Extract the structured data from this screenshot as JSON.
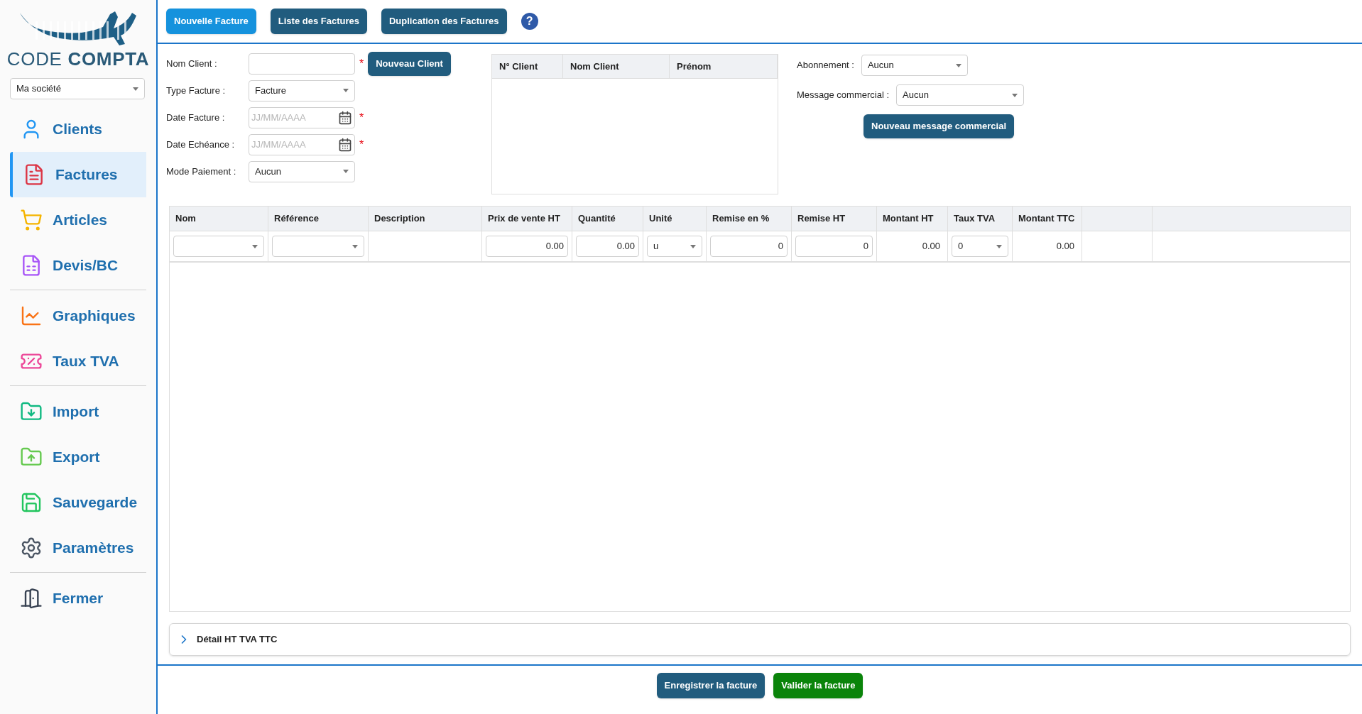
{
  "logo": {
    "word_1": "CODE",
    "word_2": "COMPTA"
  },
  "company_select": {
    "value": "Ma société"
  },
  "nav": [
    {
      "group": [
        {
          "label": "Clients",
          "selected": false
        },
        {
          "label": "Factures",
          "selected": true
        },
        {
          "label": "Articles",
          "selected": false
        },
        {
          "label": "Devis/BC",
          "selected": false
        }
      ]
    },
    {
      "group": [
        {
          "label": "Graphiques",
          "selected": false
        },
        {
          "label": "Taux TVA",
          "selected": false
        }
      ]
    },
    {
      "group": [
        {
          "label": "Import",
          "selected": false
        },
        {
          "label": "Export",
          "selected": false
        },
        {
          "label": "Sauvegarde",
          "selected": false
        },
        {
          "label": "Paramètres",
          "selected": false
        }
      ]
    },
    {
      "group": [
        {
          "label": "Fermer",
          "selected": false
        }
      ]
    }
  ],
  "top_tabs": [
    {
      "label": "Nouvelle Facture",
      "selected": true
    },
    {
      "label": "Liste des Factures",
      "selected": false
    },
    {
      "label": "Duplication des Factures",
      "selected": false
    }
  ],
  "help": {
    "label": "?"
  },
  "form": [
    {
      "label": "Nom Client :",
      "kind": "input",
      "required": true
    },
    {
      "label": "Type Facture :",
      "kind": "select",
      "value": "Facture",
      "required": false
    },
    {
      "label": "Date Facture :",
      "kind": "date",
      "placeholder": "JJ/MM/AAAA",
      "required": true
    },
    {
      "label": "Date Echéance :",
      "kind": "date",
      "placeholder": "JJ/MM/AAAA",
      "required": true
    },
    {
      "label": "Mode Paiement :",
      "kind": "select",
      "value": "Aucun",
      "required": false
    }
  ],
  "required_mark": "*",
  "new_client_button": "Nouveau Client",
  "client_table": {
    "columns": [
      "N° Client",
      "Nom Client",
      "Prénom"
    ]
  },
  "subscription": {
    "label": "Abonnement :",
    "value": "Aucun"
  },
  "commercial_message": {
    "label": "Message commercial :",
    "value": "Aucun"
  },
  "new_message_button": "Nouveau message commercial",
  "lines_table": {
    "columns": [
      {
        "label": "Nom",
        "kind": "select"
      },
      {
        "label": "Référence",
        "kind": "select"
      },
      {
        "label": "Description",
        "kind": "text"
      },
      {
        "label": "Prix de vente HT",
        "kind": "input",
        "value": "0.00"
      },
      {
        "label": "Quantité",
        "kind": "input",
        "value": "0.00"
      },
      {
        "label": "Unité",
        "kind": "select",
        "value": "u"
      },
      {
        "label": "Remise en %",
        "kind": "input",
        "value": "0"
      },
      {
        "label": "Remise HT",
        "kind": "input",
        "value": "0"
      },
      {
        "label": "Montant HT",
        "kind": "text",
        "value": "0.00"
      },
      {
        "label": "Taux TVA",
        "kind": "select",
        "value": "0"
      },
      {
        "label": "Montant TTC",
        "kind": "text",
        "value": "0.00"
      }
    ]
  },
  "detail_panel": {
    "title": "Détail HT TVA TTC",
    "expanded": false
  },
  "footer_buttons": [
    {
      "label": "Enregistrer la facture",
      "kind": "save"
    },
    {
      "label": "Valider la facture",
      "kind": "validate"
    }
  ]
}
